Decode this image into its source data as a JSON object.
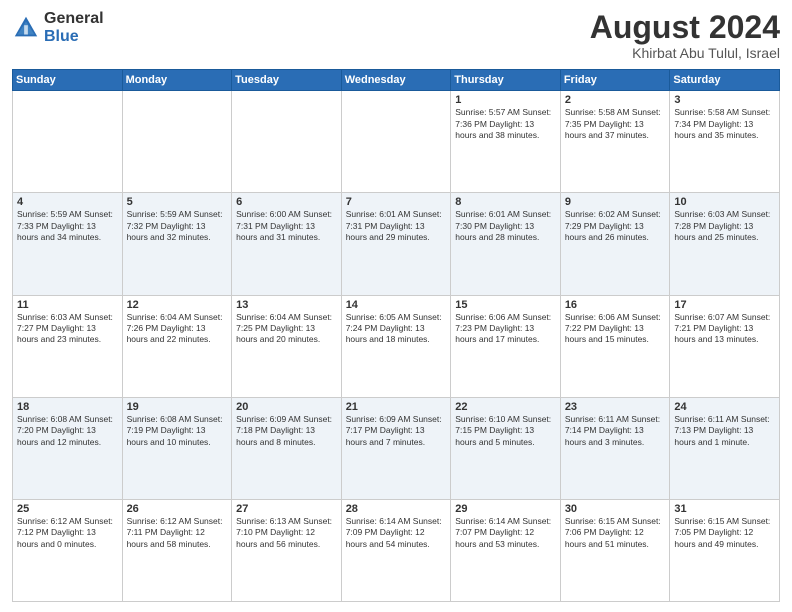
{
  "header": {
    "logo_general": "General",
    "logo_blue": "Blue",
    "month": "August 2024",
    "location": "Khirbat Abu Tulul, Israel"
  },
  "weekdays": [
    "Sunday",
    "Monday",
    "Tuesday",
    "Wednesday",
    "Thursday",
    "Friday",
    "Saturday"
  ],
  "weeks": [
    [
      {
        "day": "",
        "info": ""
      },
      {
        "day": "",
        "info": ""
      },
      {
        "day": "",
        "info": ""
      },
      {
        "day": "",
        "info": ""
      },
      {
        "day": "1",
        "info": "Sunrise: 5:57 AM\nSunset: 7:36 PM\nDaylight: 13 hours\nand 38 minutes."
      },
      {
        "day": "2",
        "info": "Sunrise: 5:58 AM\nSunset: 7:35 PM\nDaylight: 13 hours\nand 37 minutes."
      },
      {
        "day": "3",
        "info": "Sunrise: 5:58 AM\nSunset: 7:34 PM\nDaylight: 13 hours\nand 35 minutes."
      }
    ],
    [
      {
        "day": "4",
        "info": "Sunrise: 5:59 AM\nSunset: 7:33 PM\nDaylight: 13 hours\nand 34 minutes."
      },
      {
        "day": "5",
        "info": "Sunrise: 5:59 AM\nSunset: 7:32 PM\nDaylight: 13 hours\nand 32 minutes."
      },
      {
        "day": "6",
        "info": "Sunrise: 6:00 AM\nSunset: 7:31 PM\nDaylight: 13 hours\nand 31 minutes."
      },
      {
        "day": "7",
        "info": "Sunrise: 6:01 AM\nSunset: 7:31 PM\nDaylight: 13 hours\nand 29 minutes."
      },
      {
        "day": "8",
        "info": "Sunrise: 6:01 AM\nSunset: 7:30 PM\nDaylight: 13 hours\nand 28 minutes."
      },
      {
        "day": "9",
        "info": "Sunrise: 6:02 AM\nSunset: 7:29 PM\nDaylight: 13 hours\nand 26 minutes."
      },
      {
        "day": "10",
        "info": "Sunrise: 6:03 AM\nSunset: 7:28 PM\nDaylight: 13 hours\nand 25 minutes."
      }
    ],
    [
      {
        "day": "11",
        "info": "Sunrise: 6:03 AM\nSunset: 7:27 PM\nDaylight: 13 hours\nand 23 minutes."
      },
      {
        "day": "12",
        "info": "Sunrise: 6:04 AM\nSunset: 7:26 PM\nDaylight: 13 hours\nand 22 minutes."
      },
      {
        "day": "13",
        "info": "Sunrise: 6:04 AM\nSunset: 7:25 PM\nDaylight: 13 hours\nand 20 minutes."
      },
      {
        "day": "14",
        "info": "Sunrise: 6:05 AM\nSunset: 7:24 PM\nDaylight: 13 hours\nand 18 minutes."
      },
      {
        "day": "15",
        "info": "Sunrise: 6:06 AM\nSunset: 7:23 PM\nDaylight: 13 hours\nand 17 minutes."
      },
      {
        "day": "16",
        "info": "Sunrise: 6:06 AM\nSunset: 7:22 PM\nDaylight: 13 hours\nand 15 minutes."
      },
      {
        "day": "17",
        "info": "Sunrise: 6:07 AM\nSunset: 7:21 PM\nDaylight: 13 hours\nand 13 minutes."
      }
    ],
    [
      {
        "day": "18",
        "info": "Sunrise: 6:08 AM\nSunset: 7:20 PM\nDaylight: 13 hours\nand 12 minutes."
      },
      {
        "day": "19",
        "info": "Sunrise: 6:08 AM\nSunset: 7:19 PM\nDaylight: 13 hours\nand 10 minutes."
      },
      {
        "day": "20",
        "info": "Sunrise: 6:09 AM\nSunset: 7:18 PM\nDaylight: 13 hours\nand 8 minutes."
      },
      {
        "day": "21",
        "info": "Sunrise: 6:09 AM\nSunset: 7:17 PM\nDaylight: 13 hours\nand 7 minutes."
      },
      {
        "day": "22",
        "info": "Sunrise: 6:10 AM\nSunset: 7:15 PM\nDaylight: 13 hours\nand 5 minutes."
      },
      {
        "day": "23",
        "info": "Sunrise: 6:11 AM\nSunset: 7:14 PM\nDaylight: 13 hours\nand 3 minutes."
      },
      {
        "day": "24",
        "info": "Sunrise: 6:11 AM\nSunset: 7:13 PM\nDaylight: 13 hours\nand 1 minute."
      }
    ],
    [
      {
        "day": "25",
        "info": "Sunrise: 6:12 AM\nSunset: 7:12 PM\nDaylight: 13 hours\nand 0 minutes."
      },
      {
        "day": "26",
        "info": "Sunrise: 6:12 AM\nSunset: 7:11 PM\nDaylight: 12 hours\nand 58 minutes."
      },
      {
        "day": "27",
        "info": "Sunrise: 6:13 AM\nSunset: 7:10 PM\nDaylight: 12 hours\nand 56 minutes."
      },
      {
        "day": "28",
        "info": "Sunrise: 6:14 AM\nSunset: 7:09 PM\nDaylight: 12 hours\nand 54 minutes."
      },
      {
        "day": "29",
        "info": "Sunrise: 6:14 AM\nSunset: 7:07 PM\nDaylight: 12 hours\nand 53 minutes."
      },
      {
        "day": "30",
        "info": "Sunrise: 6:15 AM\nSunset: 7:06 PM\nDaylight: 12 hours\nand 51 minutes."
      },
      {
        "day": "31",
        "info": "Sunrise: 6:15 AM\nSunset: 7:05 PM\nDaylight: 12 hours\nand 49 minutes."
      }
    ]
  ]
}
